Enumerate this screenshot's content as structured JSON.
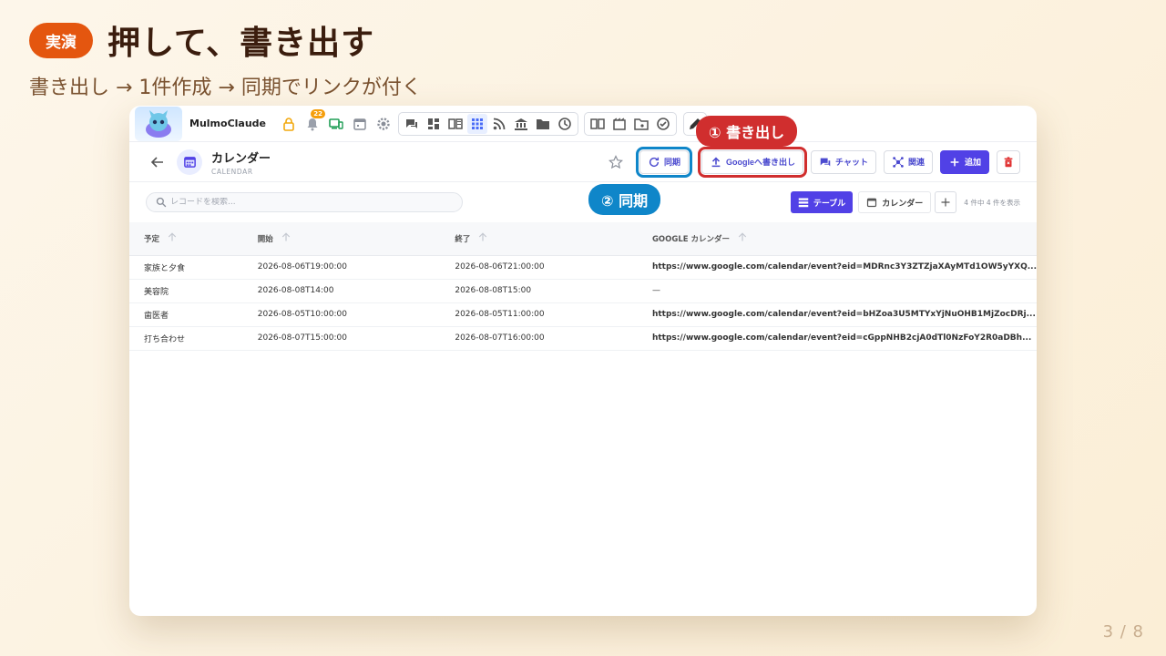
{
  "slide": {
    "badge": "実演",
    "title": "押して、書き出す",
    "subtitle": "書き出し → 1件作成 → 同期でリンクが付く",
    "page": "3 / 8"
  },
  "app": {
    "name": "MulmoClaude",
    "notification_count": "22"
  },
  "callouts": {
    "export": "① 書き出し",
    "sync": "② 同期"
  },
  "header": {
    "title": "カレンダー",
    "subtitle": "CALENDAR",
    "sync_label": "同期",
    "export_label": "Googleへ書き出し",
    "chat_label": "チャット",
    "related_label": "関連",
    "add_label": "追加"
  },
  "toolbar": {
    "search_placeholder": "レコードを検索...",
    "table_view": "テーブル",
    "calendar_view": "カレンダー",
    "count": "4 件中 4 件を表示"
  },
  "table": {
    "columns": [
      "予定",
      "開始",
      "終了",
      "GOOGLE カレンダー"
    ],
    "rows": [
      [
        "家族と夕食",
        "2026-08-06T19:00:00",
        "2026-08-06T21:00:00",
        "https://www.google.com/calendar/event?eid=MDRnc3Y3ZTZjaXAyMTd1OW5yYXQ..."
      ],
      [
        "美容院",
        "2026-08-08T14:00",
        "2026-08-08T15:00",
        "—"
      ],
      [
        "歯医者",
        "2026-08-05T10:00:00",
        "2026-08-05T11:00:00",
        "https://www.google.com/calendar/event?eid=bHZoa3U5MTYxYjNuOHB1MjZocDRj..."
      ],
      [
        "打ち合わせ",
        "2026-08-07T15:00:00",
        "2026-08-07T16:00:00",
        "https://www.google.com/calendar/event?eid=cGppNHB2cjA0dTl0NzFoY2R0aDBh..."
      ]
    ]
  },
  "colors": {
    "accent": "#5141e6",
    "export_highlight": "#d02e2e",
    "sync_highlight": "#0f86c9",
    "badge": "#e4560f"
  }
}
